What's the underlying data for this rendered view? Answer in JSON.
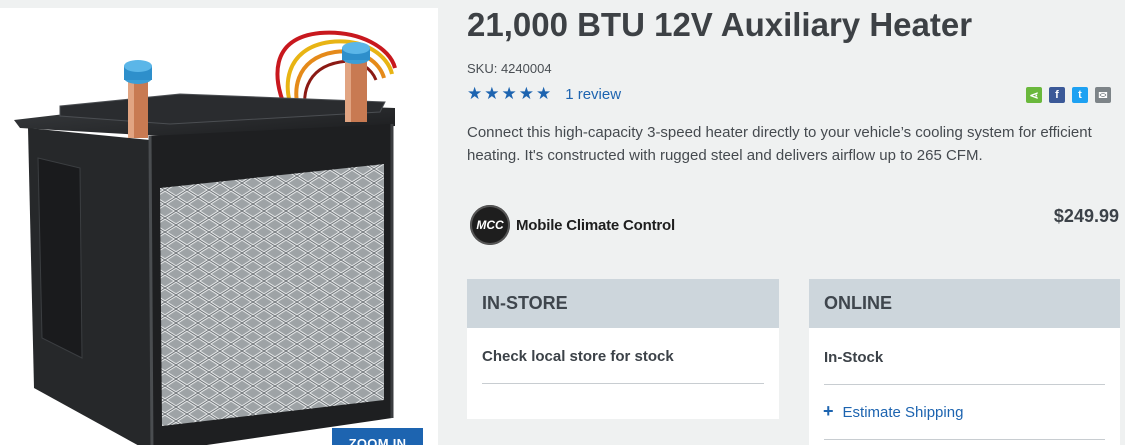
{
  "product": {
    "title": "21,000 BTU 12V Auxiliary Heater",
    "sku": "SKU: 4240004",
    "rating_stars": "★★★★★",
    "rating_value": 5,
    "review_link": "1 review",
    "description": "Connect this high-capacity 3-speed heater directly to your vehicle’s cooling system for efficient heating. It's constructed with rugged steel and delivers airflow up to 265 CFM.",
    "price": "$249.99"
  },
  "brand": {
    "logo_text": "MCC",
    "name": "Mobile Climate Control"
  },
  "image": {
    "zoom_label": "ZOOM IN"
  },
  "share": {
    "icons": [
      "share-icon",
      "facebook-icon",
      "twitter-icon",
      "email-icon"
    ],
    "share_glyph": "⋖",
    "facebook_glyph": "f",
    "twitter_glyph": "t",
    "email_glyph": "✉"
  },
  "availability": {
    "in_store": {
      "heading": "IN-STORE",
      "status": "Check local store for stock"
    },
    "online": {
      "heading": "ONLINE",
      "status": "In-Stock",
      "estimate_icon": "+",
      "estimate_label": "Estimate Shipping"
    }
  },
  "colors": {
    "accent": "#1d64b0",
    "background": "#eff1f1",
    "box_header": "#cdd6dc"
  }
}
